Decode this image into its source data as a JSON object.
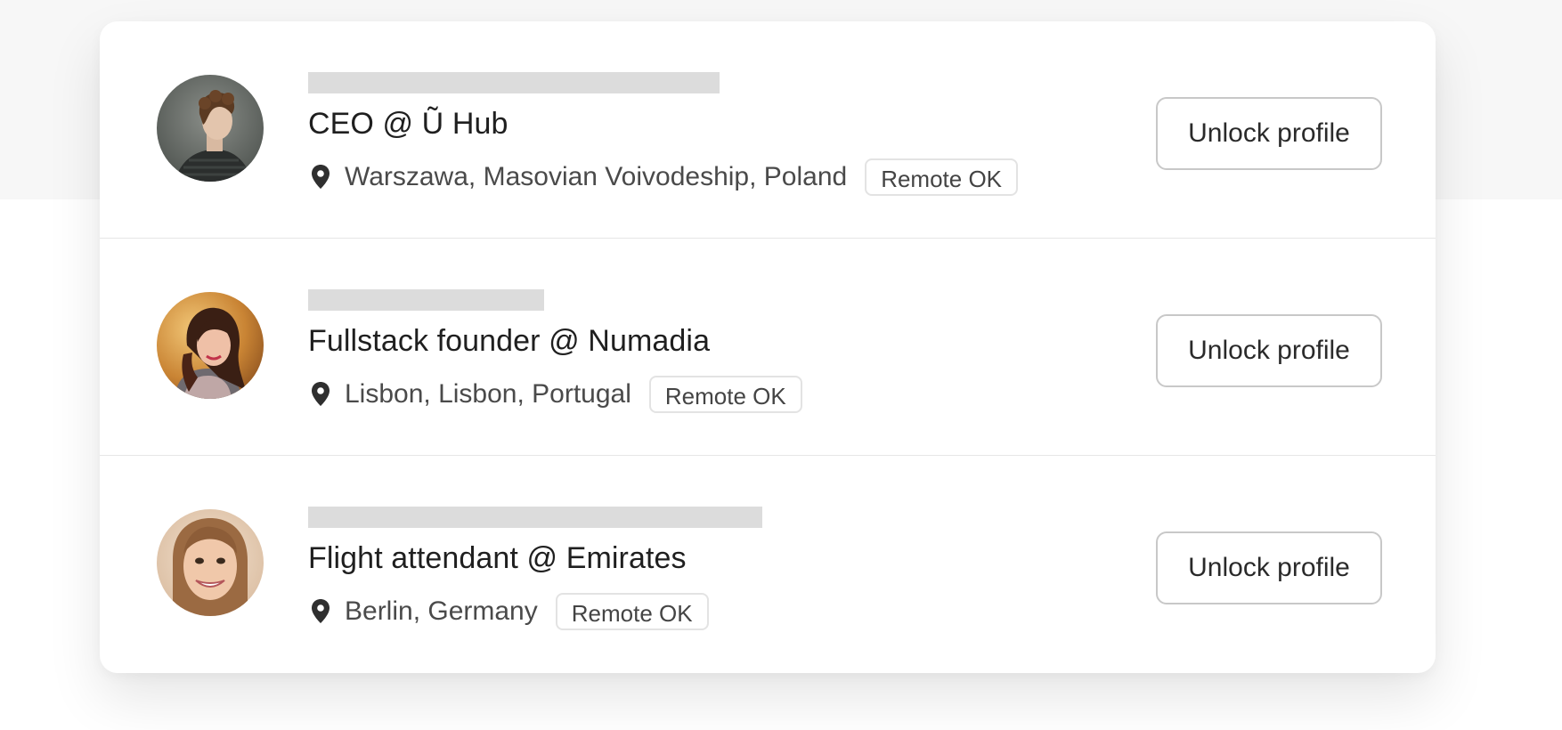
{
  "candidates": [
    {
      "title": "CEO @ Ũ Hub",
      "location": "Warszawa, Masovian Voivodeship, Poland",
      "badge": "Remote OK",
      "button_label": "Unlock profile",
      "avatar": "avatar-photo"
    },
    {
      "title": "Fullstack founder @ Numadia",
      "location": "Lisbon, Lisbon, Portugal",
      "badge": "Remote OK",
      "button_label": "Unlock profile",
      "avatar": "avatar-photo"
    },
    {
      "title": "Flight attendant @ Emirates",
      "location": "Berlin, Germany",
      "badge": "Remote OK",
      "button_label": "Unlock profile",
      "avatar": "avatar-photo"
    }
  ],
  "icons": {
    "location": "map-pin-icon"
  },
  "colors": {
    "redacted_bar": "#dcdcdc",
    "title_text": "#1f1f1f",
    "muted_text": "#4a4a4a",
    "button_border": "#c8c8c8"
  }
}
